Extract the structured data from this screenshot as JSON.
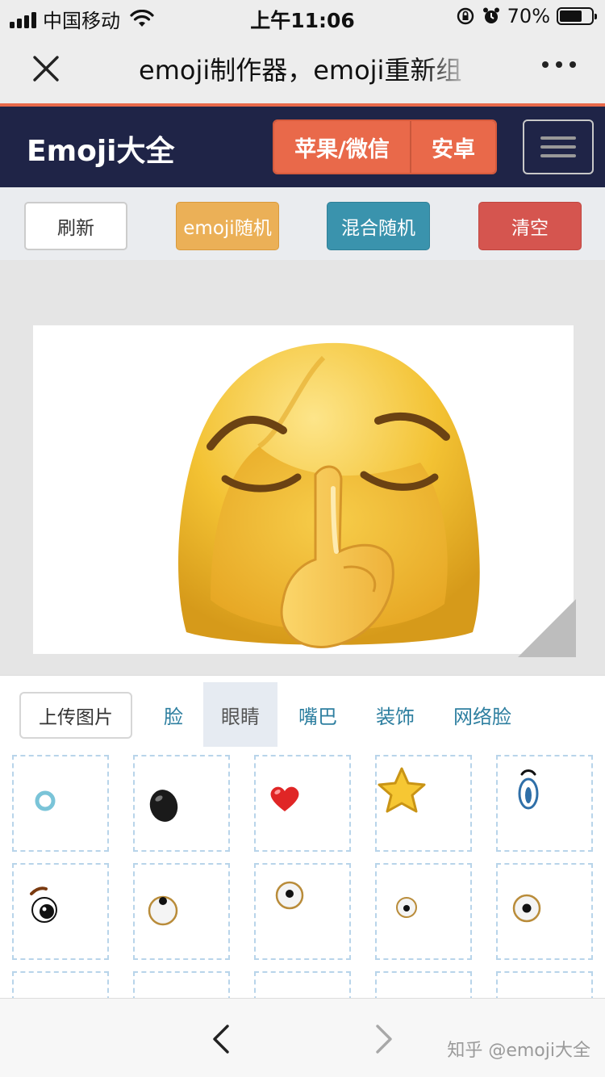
{
  "status_bar": {
    "carrier": "中国移动",
    "time": "上午11:06",
    "battery_pct": "70%",
    "battery_level": 0.7,
    "icons": [
      "signal-icon",
      "wifi-icon",
      "rotation-lock-icon",
      "alarm-icon",
      "battery-icon"
    ]
  },
  "header": {
    "title": "emoji制作器，emoji重新组",
    "icons": [
      "close-icon",
      "more-icon"
    ]
  },
  "site_nav": {
    "brand": "Emoji大全",
    "apple_label": "苹果/微信",
    "android_label": "安卓",
    "icons": [
      "hamburger-menu-icon"
    ]
  },
  "actions": {
    "refresh": "刷新",
    "emoji_random": "emoji随机",
    "mix_random": "混合随机",
    "clear": "清空"
  },
  "panel": {
    "upload": "上传图片",
    "tabs": [
      "脸",
      "眼睛",
      "嘴巴",
      "装饰",
      "网络脸"
    ],
    "active_tab": "眼睛",
    "items": [
      "ring-eye-icon",
      "black-oval-eye-icon",
      "heart-eye-icon",
      "star-eye-icon",
      "tall-oval-eye-icon",
      "winking-brow-eye-icon",
      "rolling-eye-icon",
      "looking-up-eye-icon",
      "small-pupil-eye-icon",
      "round-eye-icon"
    ]
  },
  "bottom": {
    "watermark": "知乎 @emoji大全",
    "icons": [
      "back-icon",
      "forward-icon"
    ]
  },
  "colors": {
    "navbar": "#1f2447",
    "accent_orange": "#e9694a",
    "btn_yellow": "#ebb057",
    "btn_teal": "#3a93ad",
    "btn_red": "#d5554f",
    "tab_text": "#2e7fa0"
  }
}
